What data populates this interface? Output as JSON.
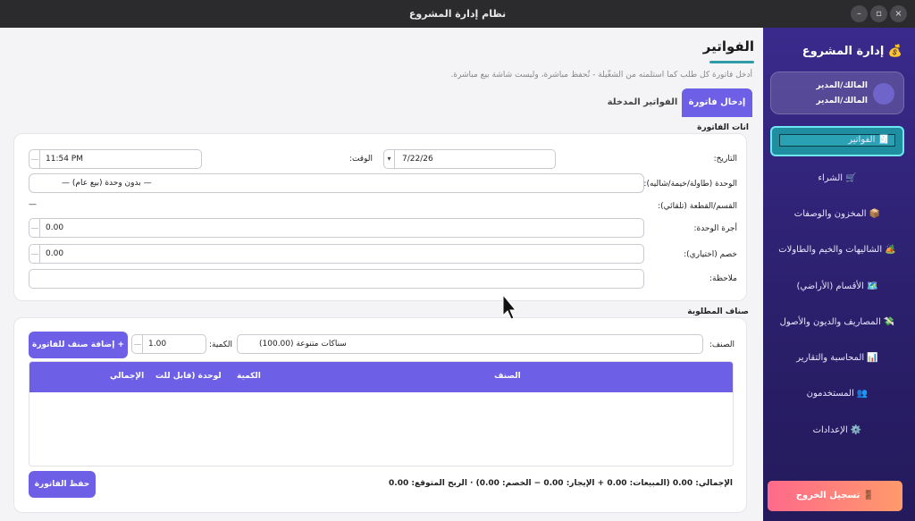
{
  "window": {
    "title": "نظام إدارة المشروع",
    "controls": [
      "–",
      "▫",
      "×"
    ]
  },
  "sidebar": {
    "title": "💰 إدارة المشروع",
    "user": {
      "line1": "المالك/المدير",
      "line2": "المالك/المدير"
    },
    "items": [
      {
        "label": "🧾 الفواتير",
        "active": true
      },
      {
        "label": "🛒 الشراء"
      },
      {
        "label": "📦 المخزون والوصفات"
      },
      {
        "label": "🏕️ الشاليهات والخيم والطاولات"
      },
      {
        "label": "🗺️ الأقسام (الأراضي)"
      },
      {
        "label": "💸 المصاريف والديون والأصول"
      },
      {
        "label": "📊 المحاسبة والتقارير"
      },
      {
        "label": "👥 المستخدمون"
      },
      {
        "label": "⚙️ الإعدادات"
      }
    ],
    "logout": "🚪 تسجيل الخروج"
  },
  "main": {
    "title": "الفواتير",
    "subtitle": "أدخل فاتورة كل طلب كما استلمته من الشغّيلة - تُحفظ مباشرة، وليست شاشة بيع مباشرة.",
    "tabs": {
      "entry": "إدخال فاتورة",
      "entered": "الفواتير المدخلة"
    },
    "invoice_section": {
      "title": "انات الفاتورة",
      "date_label": "التاريخ:",
      "date_value": "7/22/26",
      "time_label": "الوقت:",
      "time_value": "11:54 PM",
      "unit_label": "الوحدة (طاولة/خيمة/شاليه):",
      "unit_value": "— بدون وحدة (بيع عام) —",
      "section_label": "القسم/القطعة (تلقائي):",
      "section_value": "—",
      "unit_fee_label": "أجرة الوحدة:",
      "unit_fee_value": "0.00",
      "discount_label": "خصم (اختياري):",
      "discount_value": "0.00",
      "note_label": "ملاحظة:",
      "note_value": ""
    },
    "items_section": {
      "title": "صناف المطلوبة",
      "item_label": "الصنف:",
      "item_value": "سناكات متنوعة (100.00)",
      "qty_label": "الكمية:",
      "qty_value": "1.00",
      "add_button": "+ إضافة صنف للفاتورة",
      "columns": {
        "item": "الصنف",
        "qty": "الكمية",
        "per_unit": "لوحدة (قابل للت",
        "total": "الإجمالي"
      },
      "rows": []
    },
    "save_button": "حفظ الفاتورة",
    "summary": "الإجمالي: 0.00   (المبيعات: 0.00 + الإيجار: 0.00 − الخصم: 0.00)   ·   الربح المتوقع: 0.00"
  }
}
